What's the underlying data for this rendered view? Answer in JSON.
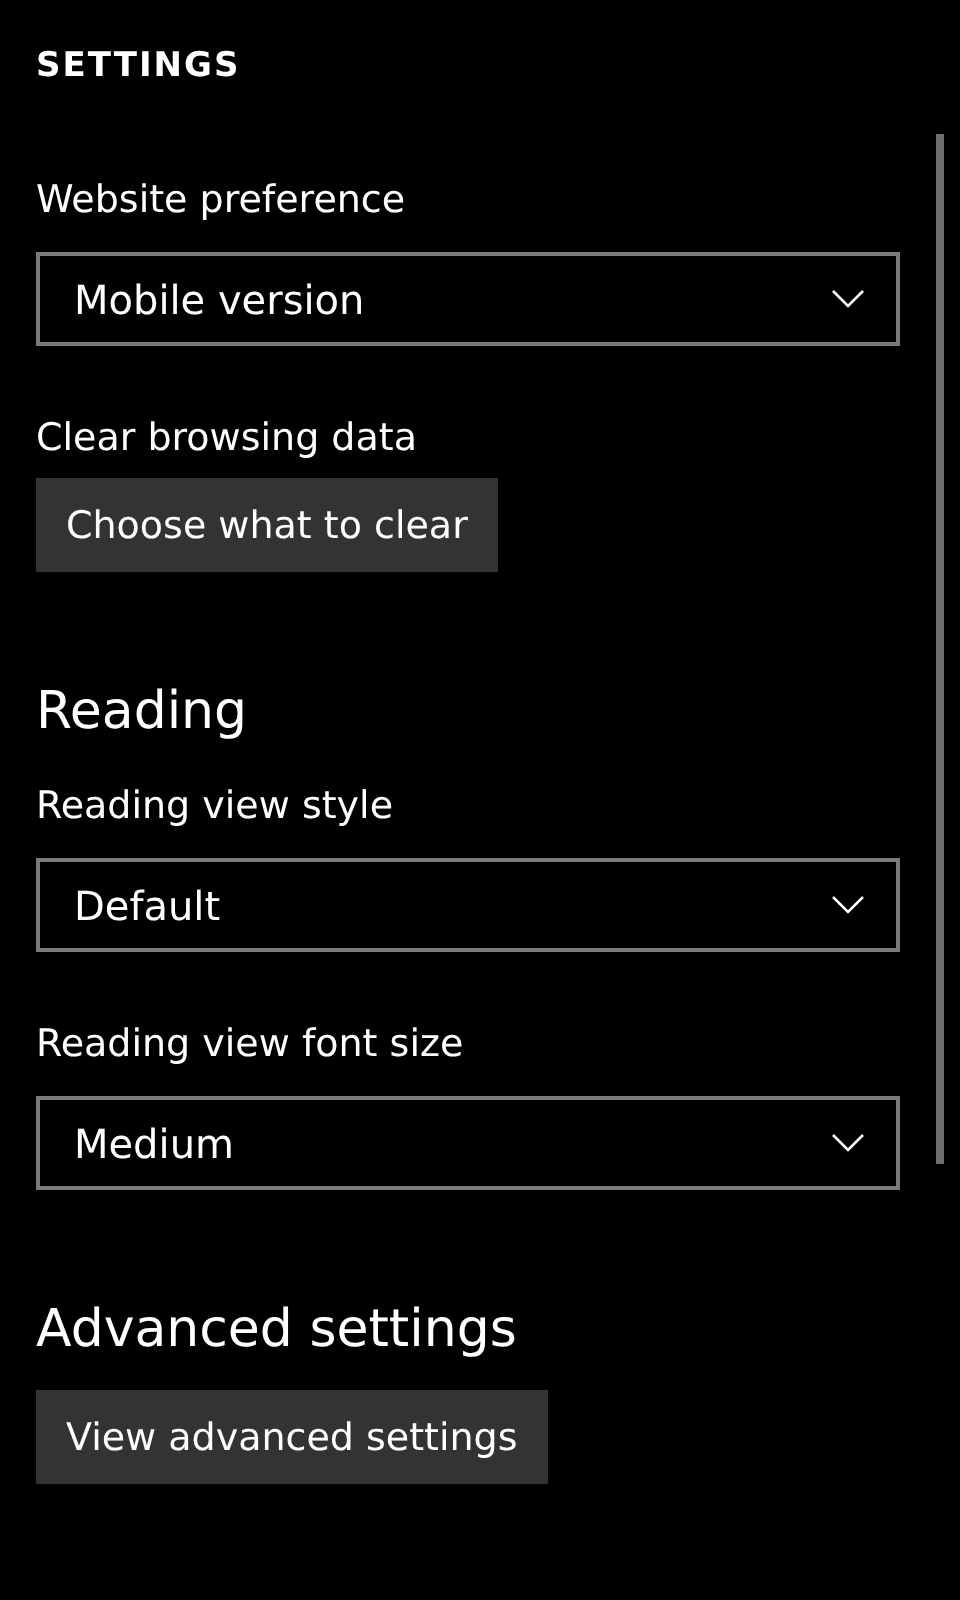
{
  "title": "SETTINGS",
  "items": [
    {
      "kind": "label",
      "text": "Website preference"
    },
    {
      "kind": "dropdown",
      "value": "Mobile version"
    },
    {
      "kind": "label",
      "text": "Clear browsing data"
    },
    {
      "kind": "button",
      "text": "Choose what to clear"
    },
    {
      "kind": "heading",
      "text": "Reading"
    },
    {
      "kind": "label",
      "text": "Reading view style"
    },
    {
      "kind": "dropdown",
      "value": "Default"
    },
    {
      "kind": "label",
      "text": "Reading view font size"
    },
    {
      "kind": "dropdown",
      "value": "Medium"
    },
    {
      "kind": "heading",
      "text": "Advanced settings"
    },
    {
      "kind": "button",
      "text": "View advanced settings"
    }
  ]
}
